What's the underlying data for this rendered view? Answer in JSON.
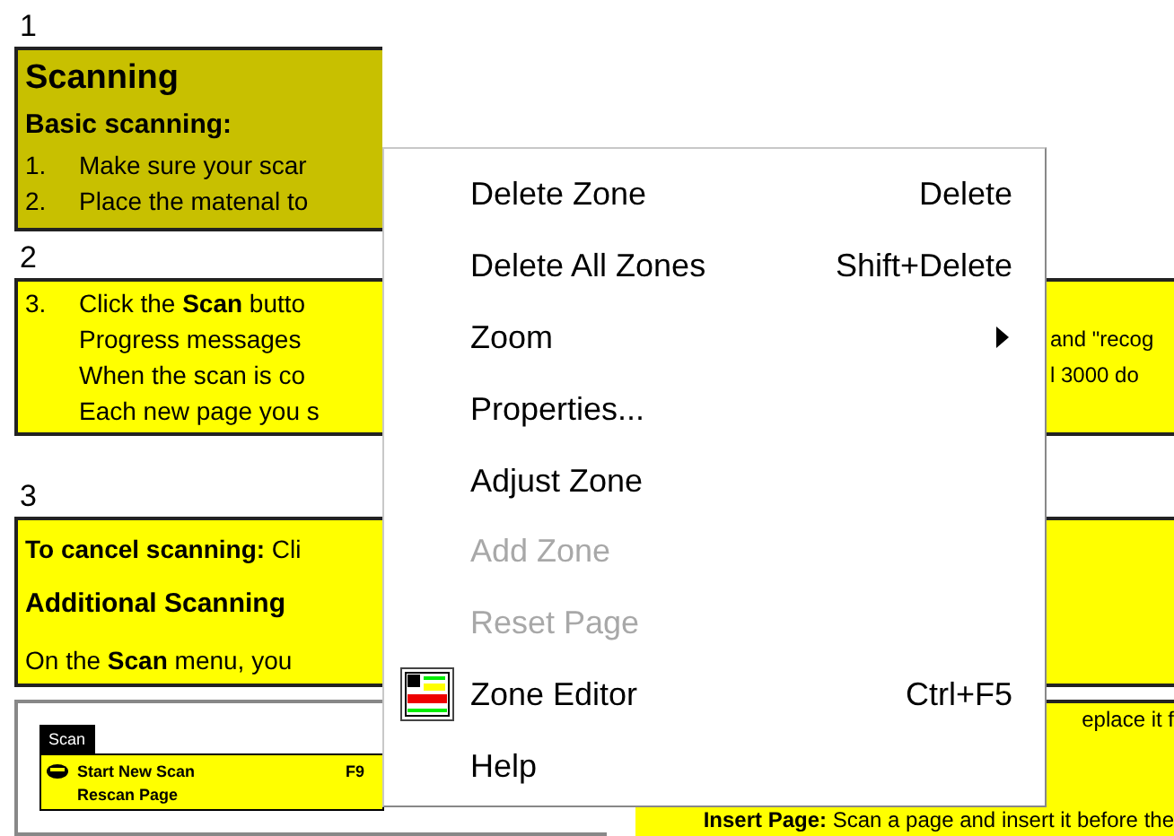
{
  "zones": [
    {
      "number": "1",
      "selected": true,
      "lines": [
        {
          "kind": "title",
          "text": "Scanning"
        },
        {
          "kind": "heading",
          "text": "Basic scanning:"
        },
        {
          "kind": "step",
          "marker": "1.",
          "text": "Make sure your scar"
        },
        {
          "kind": "step",
          "marker": "2.",
          "text": "Place the matenal to"
        }
      ]
    },
    {
      "number": "2",
      "selected": false,
      "lines": [
        {
          "kind": "step",
          "marker": "3.",
          "text": "Click the **Scan** butto"
        },
        {
          "kind": "step",
          "text": "Progress messages"
        },
        {
          "kind": "step",
          "text": "When the scan is co"
        },
        {
          "kind": "step",
          "text": "Each new page you s"
        }
      ],
      "right_lines": [
        "and \"recog",
        "l 3000 do"
      ]
    },
    {
      "number": "3",
      "selected": false,
      "lines": [
        {
          "kind": "para",
          "text": "**To cancel scanning:** Cli"
        },
        {
          "kind": "heading",
          "text": "Additional Scanning"
        },
        {
          "kind": "para",
          "text": "On the **Scan** menu, you"
        }
      ]
    }
  ],
  "embedded_menu": {
    "title": "Scan",
    "items": [
      {
        "label": "Start New Scan",
        "shortcut": "F9"
      },
      {
        "label": "Rescan Page"
      }
    ]
  },
  "side_zone": {
    "top_text": "eplace it f",
    "bottom_text": "**Insert Page:** Scan a page and insert it before the"
  },
  "context_menu": [
    {
      "label": "Delete Zone",
      "shortcut": "Delete",
      "disabled": false
    },
    {
      "label": "Delete All Zones",
      "shortcut": "Shift+Delete",
      "disabled": false
    },
    {
      "label": "Zoom",
      "submenu": true,
      "disabled": false
    },
    {
      "label": "Properties...",
      "disabled": false
    },
    {
      "label": "Adjust Zone",
      "disabled": false
    },
    {
      "label": "Add Zone",
      "disabled": true
    },
    {
      "label": "Reset Page",
      "disabled": true
    },
    {
      "label": "Zone Editor",
      "shortcut": "Ctrl+F5",
      "icon": true,
      "disabled": false
    },
    {
      "label": "Help",
      "disabled": false
    }
  ]
}
